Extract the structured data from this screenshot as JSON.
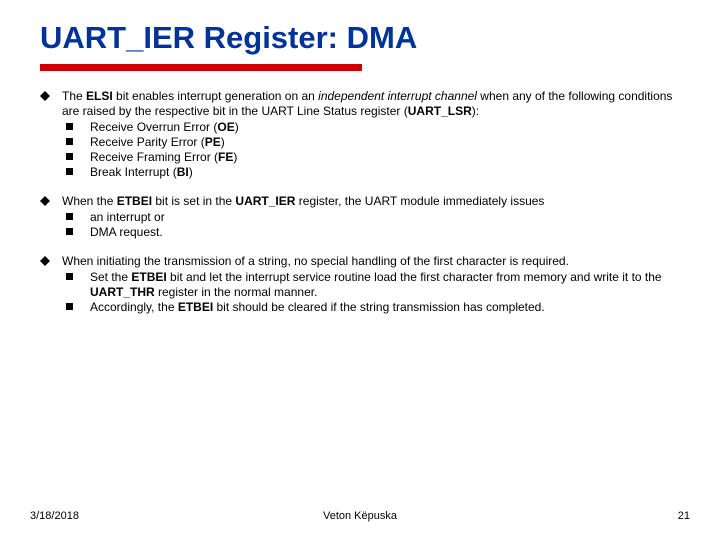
{
  "title": "UART_IER Register: DMA",
  "bullets": [
    {
      "intro_html": "The <b>ELSI</b> bit enables interrupt generation on an <i>independent interrupt channel</i> when any of the following conditions are raised by the respective bit in the UART Line Status register (<b>UART_LSR</b>):",
      "subs": [
        "Receive Overrun Error (<b>OE</b>)",
        "Receive Parity Error (<b>PE</b>)",
        "Receive Framing Error (<b>FE</b>)",
        "Break Interrupt (<b>BI</b>)"
      ]
    },
    {
      "intro_html": "When the <b>ETBEI</b> bit is set in the <b>UART_IER</b> register, the UART module immediately issues",
      "subs": [
        "an interrupt or",
        "DMA request."
      ]
    },
    {
      "intro_html": "When initiating the transmission of a string, no special handling of the first character is required.",
      "subs": [
        "Set the <b>ETBEI</b> bit and let the interrupt service routine load the first character from memory and write it to the <b>UART_THR</b> register in the normal manner.",
        "Accordingly, the <b>ETBEI</b> bit should be cleared if the string transmission has completed."
      ]
    }
  ],
  "footer": {
    "date": "3/18/2018",
    "author": "Veton Këpuska",
    "page": "21"
  }
}
